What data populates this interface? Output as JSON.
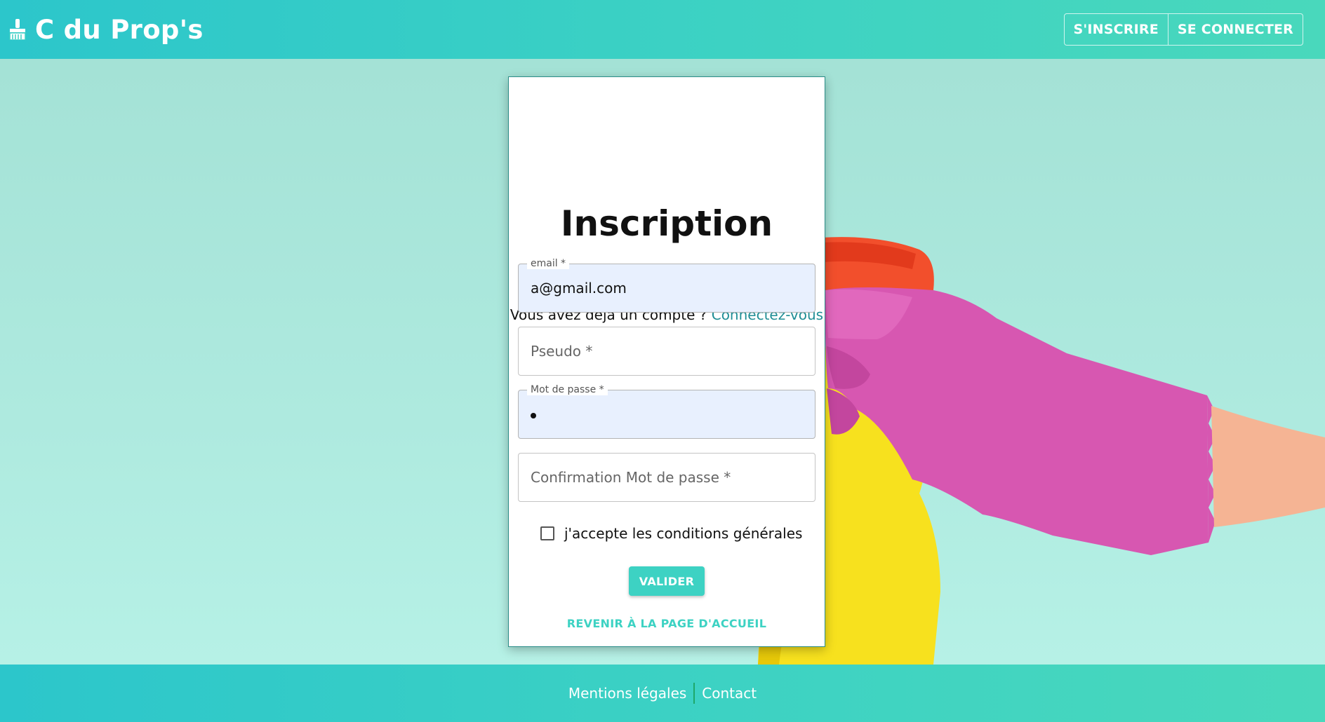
{
  "header": {
    "brand_title": "C du Prop's",
    "brand_icon": "broom-icon",
    "register_label": "S'INSCRIRE",
    "login_label": "SE CONNECTER"
  },
  "form": {
    "title": "Inscription",
    "already_account_text": "Vous avez déjà un compte ?",
    "login_link": "Connectez-vous",
    "email": {
      "label": "email *",
      "value": "a@gmail.com"
    },
    "pseudo": {
      "placeholder": "Pseudo *"
    },
    "password": {
      "label": "Mot de passe *",
      "masked_value": "•"
    },
    "confirm_password": {
      "placeholder": "Confirmation Mot de passe *"
    },
    "terms_label": "j'accepte les conditions générales",
    "terms_checked": false,
    "submit_label": "VALIDER",
    "home_link": "REVENIR À LA PAGE D'ACCUEIL"
  },
  "footer": {
    "legal_label": "Mentions légales",
    "contact_label": "Contact"
  },
  "colors": {
    "accent": "#3dd2c3",
    "header_gradient_start": "#2cc6cb",
    "link": "#1e8d95",
    "background": "#a9e7da"
  }
}
